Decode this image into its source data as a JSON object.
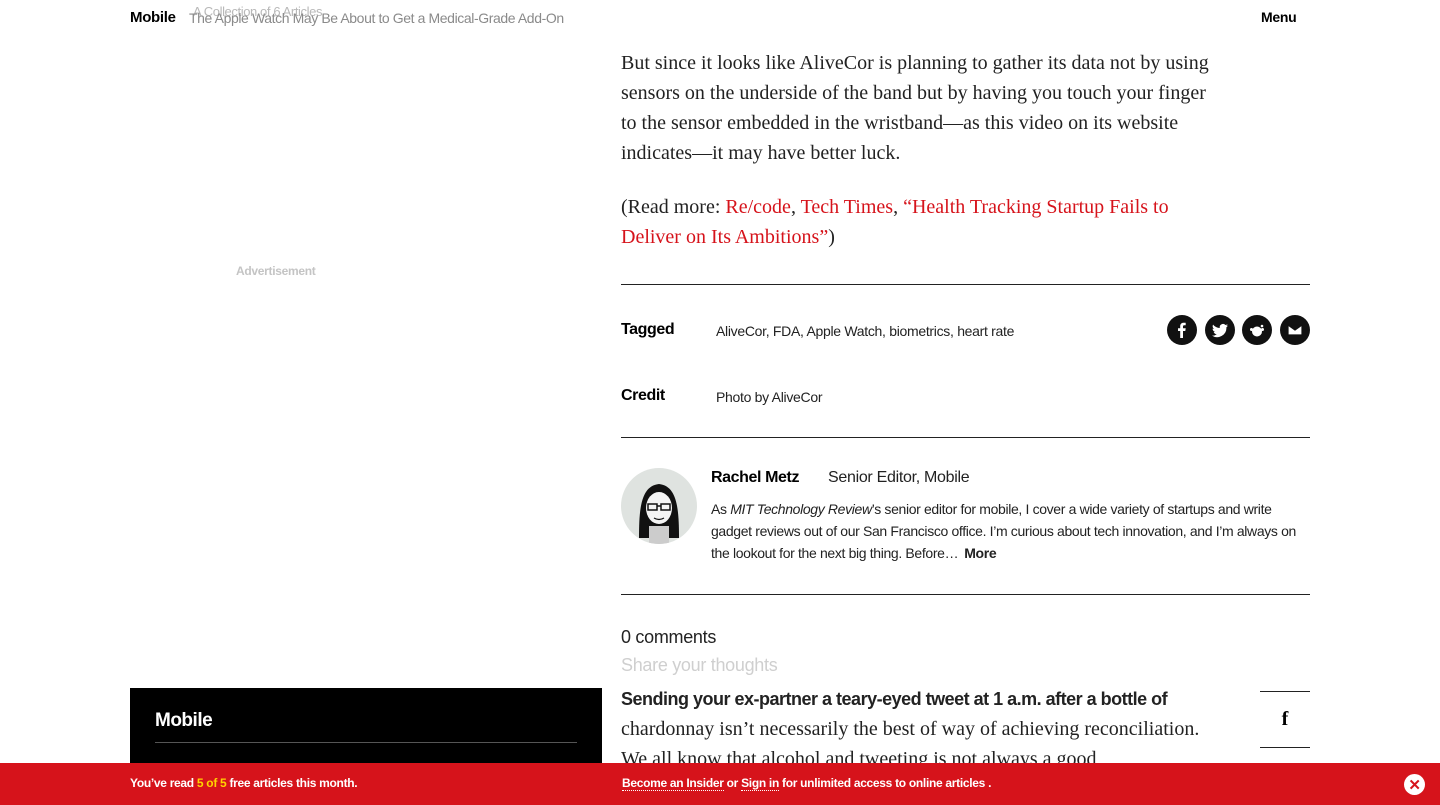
{
  "header": {
    "section": "Mobile",
    "collection": "A Collection of 6 Articles",
    "headline": "The Apple Watch May Be About to Get a Medical-Grade Add-On",
    "menu": "Menu"
  },
  "sidebar": {
    "ad_label": "Advertisement"
  },
  "article": {
    "para1": "But since it looks like AliveCor is planning to gather its data not by using sensors on the underside of the band but by having you touch your finger to the sensor embedded in the wristband—as this video on its website indicates—it may have better luck.",
    "read_more": {
      "prefix": "(Read more: ",
      "links": [
        "Re/code",
        "Tech Times",
        "“Health Tracking Startup Fails to Deliver on Its Ambitions”"
      ],
      "sep": ", ",
      "suffix": ")"
    }
  },
  "meta": {
    "tagged_label": "Tagged",
    "tags": [
      "AliveCor",
      "FDA",
      "Apple Watch",
      "biometrics",
      "heart rate"
    ],
    "credit_label": "Credit",
    "credit_value": "Photo by AliveCor"
  },
  "share_icons": [
    "facebook-icon",
    "twitter-icon",
    "reddit-icon",
    "email-icon"
  ],
  "author": {
    "name": "Rachel Metz",
    "title": "Senior Editor, Mobile",
    "bio_prefix": "As ",
    "bio_pub": "MIT Technology Review",
    "bio_rest": "’s senior editor for mobile, I cover a wide variety of startups and write gadget reviews out of our San Francisco office. I’m curious about tech innovation, and I’m always on the lookout for the next big thing. Before…",
    "more": "More"
  },
  "comments": {
    "count": "0 comments",
    "placeholder": "Share your thoughts"
  },
  "next_article": {
    "lead_bold": "Sending your ex-partner a teary-eyed tweet at 1 a.m. after a bottle of",
    "lead_rest": "chardonnay isn’t necessarily the best of way of achieving reconciliation. We all know that alcohol and tweeting is not always a good"
  },
  "side_share": {
    "icon": "f"
  },
  "section_block": {
    "title": "Mobile"
  },
  "paywall": {
    "prefix": "You’ve read ",
    "count": "5 of 5",
    "suffix": " free articles this month.",
    "insider_link": "Become an Insider",
    "or": " or ",
    "signin_link": "Sign in",
    "tail": " for unlimited access  to online articles ."
  },
  "colors": {
    "accent": "#d6131b",
    "count_highlight": "#ffd200"
  }
}
